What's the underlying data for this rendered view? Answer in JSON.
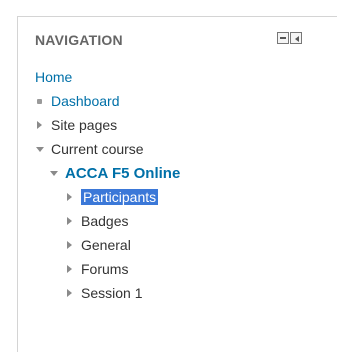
{
  "navigation": {
    "title": "NAVIGATION",
    "controls": {
      "hide_icon": "minus-box-icon",
      "dock_icon": "dock-left-icon"
    },
    "home": "Home",
    "dashboard": "Dashboard",
    "site_pages": "Site pages",
    "current_course": "Current course",
    "course_name": "ACCA F5 Online",
    "course_items": [
      {
        "label": "Participants",
        "selected": true
      },
      {
        "label": "Badges"
      },
      {
        "label": "General"
      },
      {
        "label": "Forums"
      },
      {
        "label": "Session 1"
      }
    ]
  },
  "colors": {
    "link": "#0070a8",
    "text": "#333333",
    "title": "#666666",
    "selection": "#3b78d8"
  }
}
